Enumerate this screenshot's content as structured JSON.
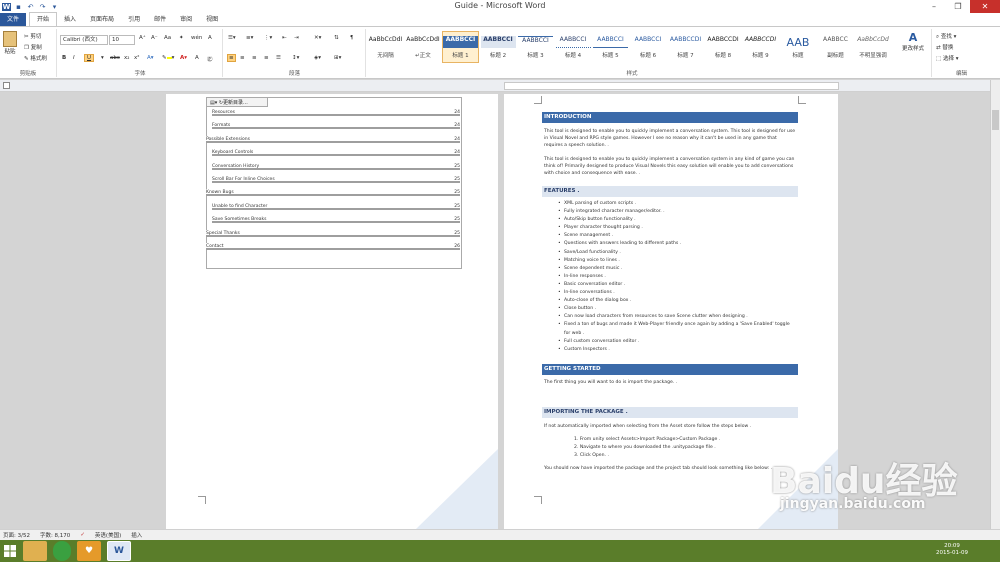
{
  "window": {
    "title": "Guide - Microsoft Word"
  },
  "tabs": [
    "文件",
    "开始",
    "插入",
    "页面布局",
    "引用",
    "邮件",
    "审阅",
    "视图"
  ],
  "active_tab": "开始",
  "clipboard": {
    "paste": "粘贴",
    "cut": "剪切",
    "copy": "复制",
    "format_painter": "格式刷",
    "label": "剪贴板"
  },
  "font": {
    "name": "Calibri (西文)",
    "size": "10",
    "label": "字体"
  },
  "paragraph": {
    "label": "段落"
  },
  "styles": {
    "label": "样式",
    "items": [
      {
        "sample": "AaBbCcDdI",
        "name": "无间隔"
      },
      {
        "sample": "AaBbCcDdI",
        "name": "↵正文"
      },
      {
        "sample": "AABBCCI",
        "name": "标题 1"
      },
      {
        "sample": "AABBCCI",
        "name": "标题 2"
      },
      {
        "sample": "AABBCCI",
        "name": "标题 3"
      },
      {
        "sample": "AABBCCI",
        "name": "标题 4"
      },
      {
        "sample": "AABBCCI",
        "name": "标题 5"
      },
      {
        "sample": "AABBCCI",
        "name": "标题 6"
      },
      {
        "sample": "AABBCCDI",
        "name": "标题 7"
      },
      {
        "sample": "AABBCCDI",
        "name": "标题 8"
      },
      {
        "sample": "AABBCCDI",
        "name": "标题 9"
      },
      {
        "sample": "AAB",
        "name": "标题"
      },
      {
        "sample": "AABBCC",
        "name": "副标题"
      },
      {
        "sample": "AaBbCcDd",
        "name": "不明显强调"
      }
    ],
    "change": "更改样式"
  },
  "editing": {
    "find": "查找",
    "replace": "替换",
    "select": "选择",
    "label": "编辑"
  },
  "toc": {
    "update_button": "更新目录...",
    "entries": [
      {
        "text": "Resources",
        "page": "24",
        "indent": true
      },
      {
        "text": "Formats",
        "page": "24",
        "indent": true
      },
      {
        "text": "Possible Extensions",
        "page": "24",
        "indent": false
      },
      {
        "text": "Keyboard Controls",
        "page": "24",
        "indent": true
      },
      {
        "text": "Conversation History",
        "page": "25",
        "indent": true
      },
      {
        "text": "Scroll Bar For Inline Choices",
        "page": "25",
        "indent": true
      },
      {
        "text": "Known Bugs",
        "page": "25",
        "indent": false
      },
      {
        "text": "Unable to find Character",
        "page": "25",
        "indent": true
      },
      {
        "text": "Save Sometimes Breaks",
        "page": "25",
        "indent": true
      },
      {
        "text": "Special Thanks",
        "page": "25",
        "indent": false
      },
      {
        "text": "Contact",
        "page": "26",
        "indent": false
      }
    ]
  },
  "page_number": "3",
  "doc": {
    "intro_title": "INTRODUCTION",
    "intro_p1": "This tool is designed to enable you to quickly implement a conversation system. This tool is designed for use in Visual Novel and RPG style games. However I see no reason why it can't be used in any game that requires a speech solution. .",
    "intro_p2": "This tool is designed to enable you to quickly implement a conversation system in any kind of game you can think of! Primarily designed to produce Visual Novels this easy solution will enable you to add conversations with choice and consequence with ease. .",
    "features_title": "FEATURES .",
    "features": [
      "XML parsing of custom scripts .",
      "Fully integrated character manager/editor. .",
      "Auto/Skip button functionality .",
      "Player character thought parsing .",
      "Scene management .",
      "Questions with answers leading to different paths .",
      "Save/Load functionality .",
      "Matching voice to lines .",
      "Scene dependent music .",
      "In-line responses .",
      "Basic conversation editor .",
      "In-line conversations .",
      "Auto-close of the dialog box .",
      "Close button .",
      "Can now load characters from resources to save Scene clutter when designing .",
      "Fixed a ton of bugs and made it Web-Player friendly once again by adding a 'Save Enabled' toggle for web .",
      "Full custom conversation editor .",
      "Custom Inspectors ."
    ],
    "getting_started_title": "GETTING STARTED",
    "getting_started_p": "The first thing you will want to do is import the package. .",
    "importing_title": "IMPORTING THE PACKAGE .",
    "importing_p": "If not automatically imported when selecting from the Asset store follow the steps below .",
    "steps": [
      "1.  From unity select Assets>Import Package>Custom Package .",
      "2.  Navigate to where you downloaded the .unitypackage file .",
      "3.  Click Open. ."
    ],
    "closing_p": "You should now have imported the package and the project tab should look something like below: ."
  },
  "status": {
    "page": "页面: 3/52",
    "words": "字数: 8,170",
    "lang": "英语(美国)",
    "mode": "插入"
  },
  "clock": {
    "time": "20:09",
    "date": "2015-01-09"
  },
  "watermark": {
    "brand": "Baidu经验",
    "url": "jingyan.baidu.com"
  }
}
